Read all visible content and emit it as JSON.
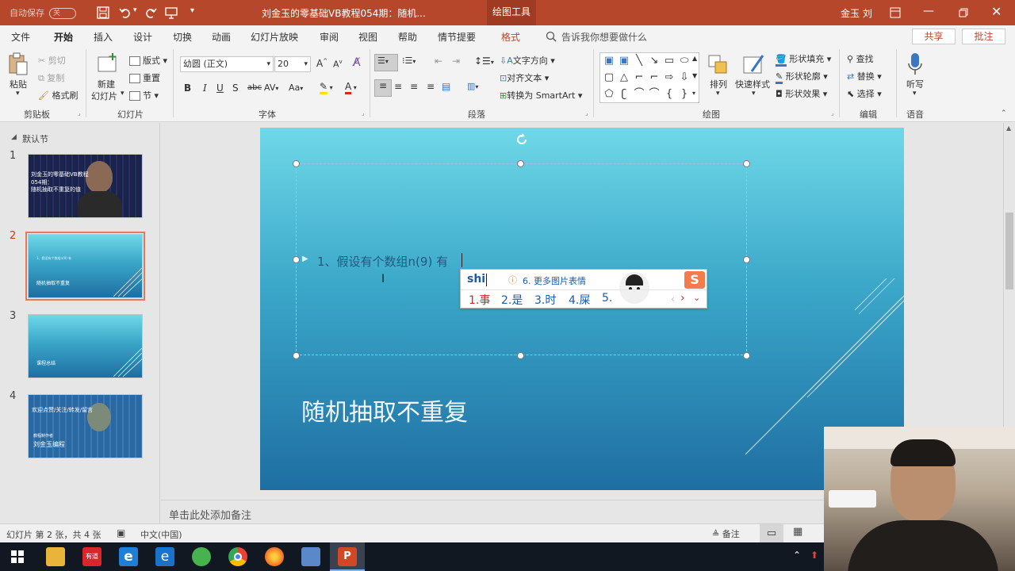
{
  "titlebar": {
    "autosave_label": "自动保存",
    "autosave_state": "关",
    "doc_title": "刘金玉的零基础VB教程054期：随机...",
    "tools_tab": "绘图工具",
    "user_name": "金玉 刘"
  },
  "ribbon_tabs": [
    "文件",
    "开始",
    "插入",
    "设计",
    "切换",
    "动画",
    "幻灯片放映",
    "审阅",
    "视图",
    "帮助",
    "情节提要",
    "格式"
  ],
  "tell_me": "告诉我你想要做什么",
  "share_label": "共享",
  "comment_label": "批注",
  "clipboard": {
    "group": "剪贴板",
    "paste": "粘贴",
    "cut": "剪切",
    "copy": "复制",
    "format_painter": "格式刷"
  },
  "slides_group": {
    "group": "幻灯片",
    "new_slide": "新建",
    "new_slide2": "幻灯片",
    "layout": "版式",
    "reset": "重置",
    "section": "节"
  },
  "font_group": {
    "group": "字体",
    "font_name": "幼圆 (正文)",
    "font_size": "20",
    "bold": "B",
    "italic": "I",
    "underline": "U",
    "shadow": "S",
    "strike": "abc",
    "spacing": "AV",
    "case": "Aa"
  },
  "paragraph_group": {
    "group": "段落",
    "text_direction": "文字方向",
    "align_text": "对齐文本",
    "smartart": "转换为 SmartArt"
  },
  "drawing_group": {
    "group": "绘图",
    "arrange": "排列",
    "quick_styles": "快速样式",
    "shape_fill": "形状填充",
    "shape_outline": "形状轮廓",
    "shape_effects": "形状效果"
  },
  "editing_group": {
    "group": "编辑",
    "find": "查找",
    "replace": "替换",
    "select": "选择"
  },
  "voice_group": {
    "group": "语音",
    "dictate": "听写"
  },
  "slide_pane": {
    "section": "默认节",
    "thumbs": [
      {
        "num": "1",
        "line1": "刘金玉的零基础VB教程",
        "line2": "054期：",
        "line3": "随机抽取不重复的值"
      },
      {
        "num": "2",
        "line1": "1、假设有个数组n(9) 有",
        "line2": "随机抽取不重复"
      },
      {
        "num": "3",
        "line1": "课程总结"
      },
      {
        "num": "4",
        "line1": "欢迎点赞/关注/转发/留言",
        "line2": "教程制作者",
        "line3": "刘金玉编程"
      }
    ]
  },
  "slide": {
    "bullet_text": "1、假设有个数组n(9) 有",
    "title": "随机抽取不重复"
  },
  "ime": {
    "input": "shi",
    "hint": "6. 更多图片表情",
    "candidates": [
      "1.事",
      "2.是",
      "3.时",
      "4.屎",
      "5."
    ]
  },
  "notes_placeholder": "单击此处添加备注",
  "status": {
    "slide_info": "幻灯片 第 2 张，共 4 张",
    "language": "中文(中国)",
    "notes": "备注"
  }
}
